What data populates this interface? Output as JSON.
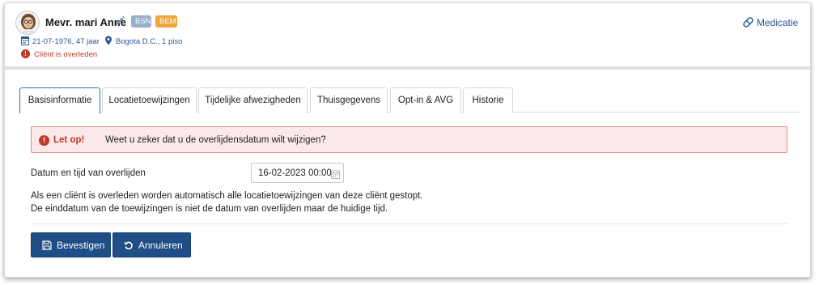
{
  "patient": {
    "name": "Mevr. mari Anne",
    "badges": {
      "bsn": "BSN",
      "bem": "BEM"
    },
    "birth_info": "21-07-1976, 47 jaar",
    "location": "Bogota D.C., 1 piso",
    "status": "Cliënt is overleden"
  },
  "header_actions": {
    "medicatie": "Medicatie"
  },
  "tabs": [
    {
      "label": "Basisinformatie",
      "active": true
    },
    {
      "label": "Locatietoewijzingen"
    },
    {
      "label": "Tijdelijke afwezigheden"
    },
    {
      "label": "Thuisgegevens"
    },
    {
      "label": "Opt-in & AVG"
    },
    {
      "label": "Historie"
    }
  ],
  "alert": {
    "lead": "Let op!",
    "message": "Weet u zeker dat u de overlijdensdatum wilt wijzigen?"
  },
  "form": {
    "death_label": "Datum en tijd van overlijden",
    "death_value": "16-02-2023 00:00",
    "info_line1": "Als een cliënt is overleden worden automatisch alle locatietoewijzingen van deze cliënt gestopt.",
    "info_line2": "De einddatum van de toewijzingen is niet de datum van overlijden maar de huidige tijd."
  },
  "buttons": {
    "confirm": "Bevestigen",
    "cancel": "Annuleren"
  },
  "colors": {
    "primary": "#1f4d86",
    "link": "#2b5797",
    "danger": "#c0392b",
    "badge_bsn": "#98aecb",
    "badge_bem": "#f0a63a"
  }
}
